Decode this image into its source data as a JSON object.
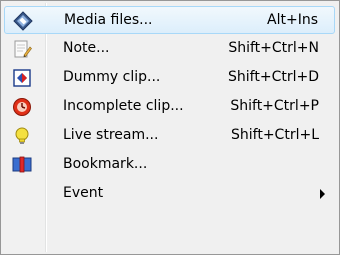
{
  "menu": {
    "items": [
      {
        "label": "Media files...",
        "shortcut": "Alt+Ins",
        "icon": "media-files-icon"
      },
      {
        "label": "Note...",
        "shortcut": "Shift+Ctrl+N",
        "icon": "note-icon"
      },
      {
        "label": "Dummy clip...",
        "shortcut": "Shift+Ctrl+D",
        "icon": "dummy-clip-icon"
      },
      {
        "label": "Incomplete clip...",
        "shortcut": "Shift+Ctrl+P",
        "icon": "incomplete-clip-icon"
      },
      {
        "label": "Live stream...",
        "shortcut": "Shift+Ctrl+L",
        "icon": "live-stream-icon"
      },
      {
        "label": "Bookmark...",
        "shortcut": "",
        "icon": "bookmark-icon"
      },
      {
        "label": "Event",
        "shortcut": "",
        "icon": "",
        "has_submenu": true
      }
    ]
  },
  "colors": {
    "highlight_border": "#a8d8f8",
    "menu_background": "#f0f0f0"
  }
}
